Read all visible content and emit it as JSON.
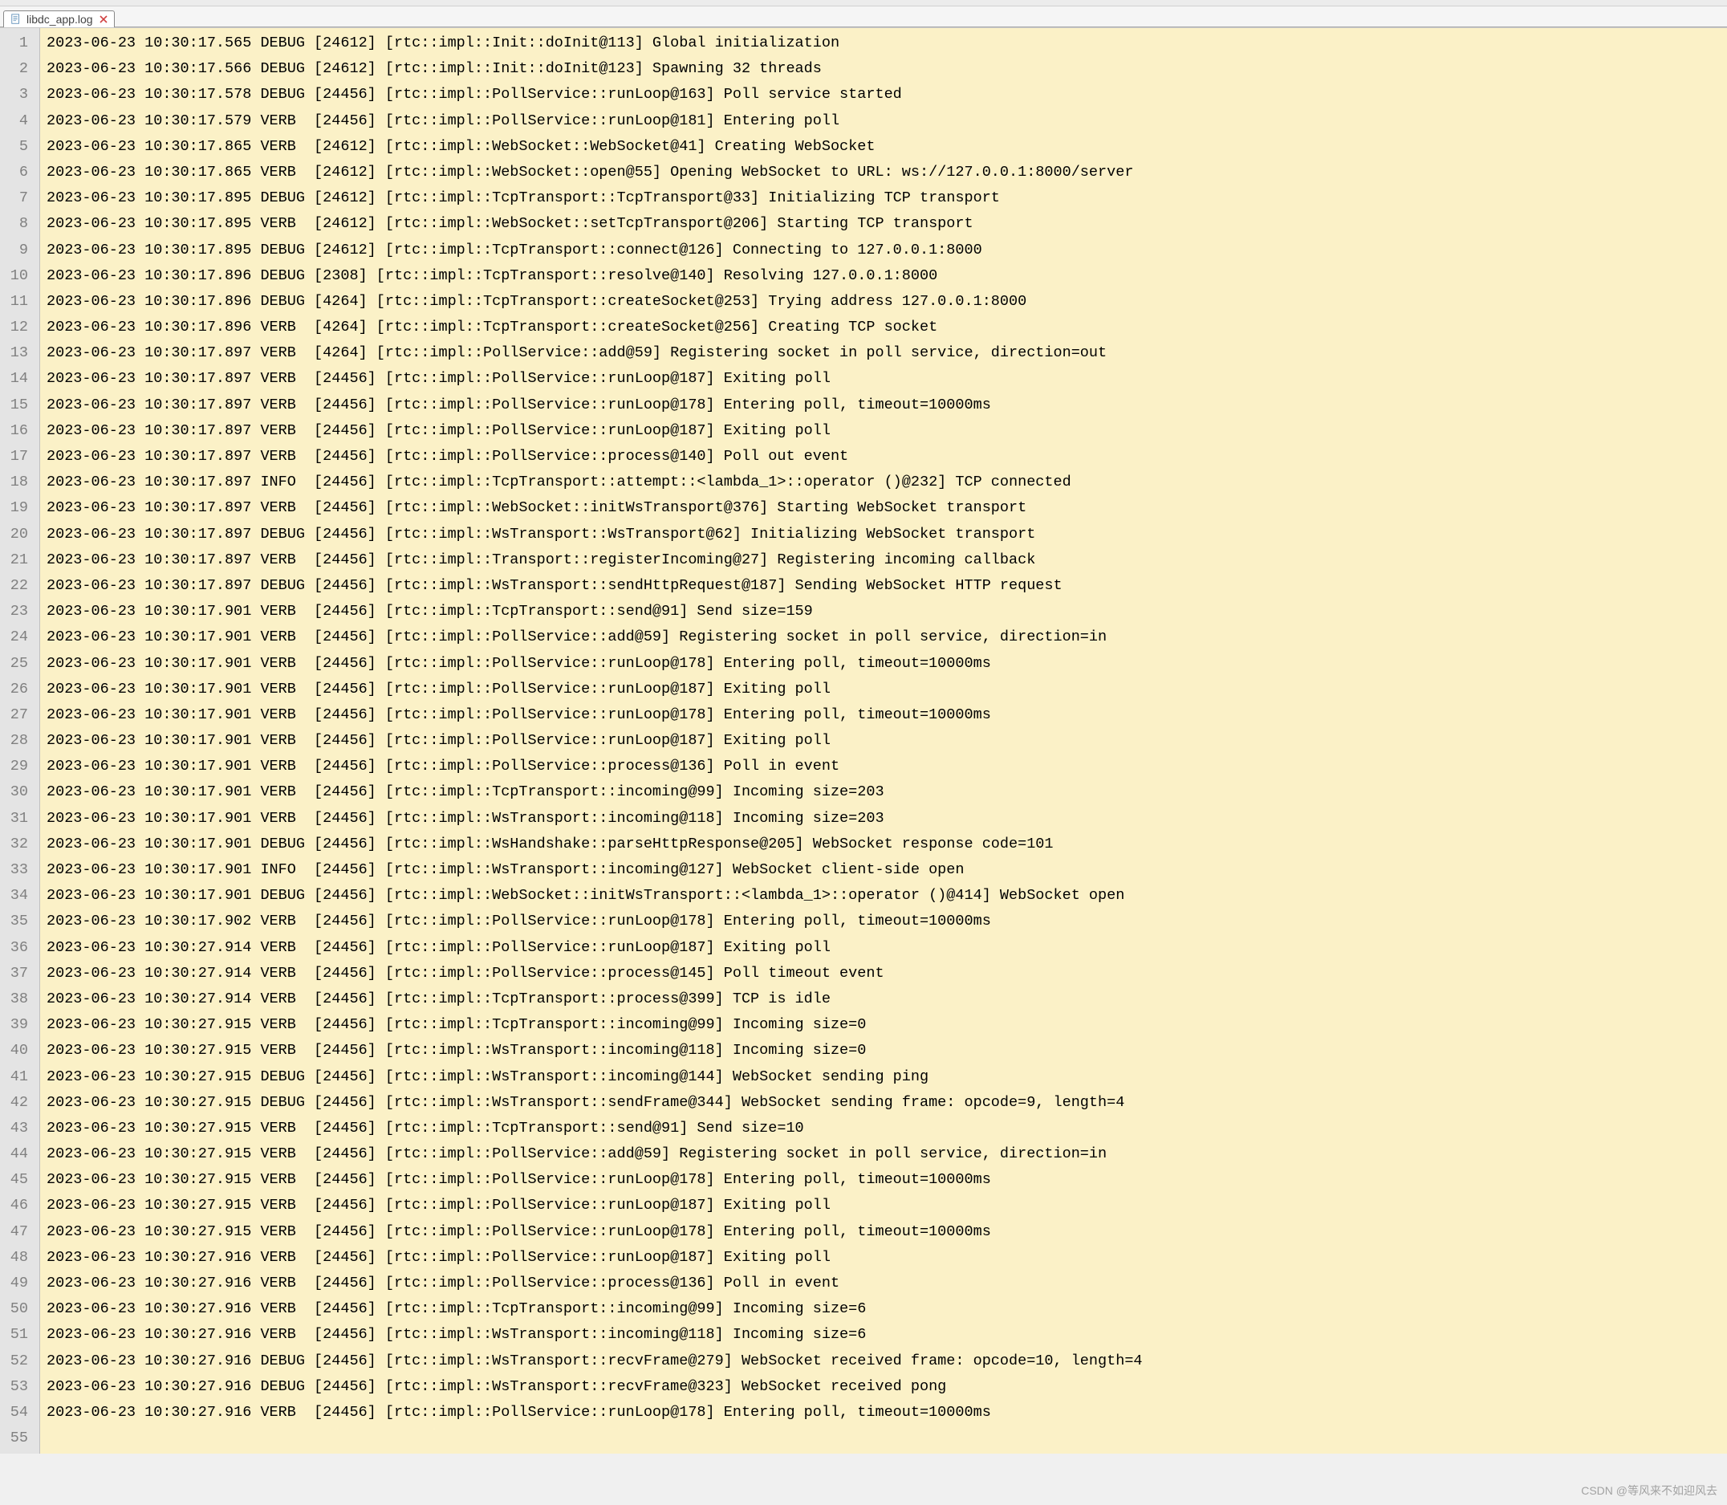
{
  "tab": {
    "filename": "libdc_app.log",
    "icon": "file-icon",
    "close": "close-icon"
  },
  "watermark": "CSDN @等风来不如迎风去",
  "log_lines": [
    "2023-06-23 10:30:17.565 DEBUG [24612] [rtc::impl::Init::doInit@113] Global initialization",
    "2023-06-23 10:30:17.566 DEBUG [24612] [rtc::impl::Init::doInit@123] Spawning 32 threads",
    "2023-06-23 10:30:17.578 DEBUG [24456] [rtc::impl::PollService::runLoop@163] Poll service started",
    "2023-06-23 10:30:17.579 VERB  [24456] [rtc::impl::PollService::runLoop@181] Entering poll",
    "2023-06-23 10:30:17.865 VERB  [24612] [rtc::impl::WebSocket::WebSocket@41] Creating WebSocket",
    "2023-06-23 10:30:17.865 VERB  [24612] [rtc::impl::WebSocket::open@55] Opening WebSocket to URL: ws://127.0.0.1:8000/server",
    "2023-06-23 10:30:17.895 DEBUG [24612] [rtc::impl::TcpTransport::TcpTransport@33] Initializing TCP transport",
    "2023-06-23 10:30:17.895 VERB  [24612] [rtc::impl::WebSocket::setTcpTransport@206] Starting TCP transport",
    "2023-06-23 10:30:17.895 DEBUG [24612] [rtc::impl::TcpTransport::connect@126] Connecting to 127.0.0.1:8000",
    "2023-06-23 10:30:17.896 DEBUG [2308] [rtc::impl::TcpTransport::resolve@140] Resolving 127.0.0.1:8000",
    "2023-06-23 10:30:17.896 DEBUG [4264] [rtc::impl::TcpTransport::createSocket@253] Trying address 127.0.0.1:8000",
    "2023-06-23 10:30:17.896 VERB  [4264] [rtc::impl::TcpTransport::createSocket@256] Creating TCP socket",
    "2023-06-23 10:30:17.897 VERB  [4264] [rtc::impl::PollService::add@59] Registering socket in poll service, direction=out",
    "2023-06-23 10:30:17.897 VERB  [24456] [rtc::impl::PollService::runLoop@187] Exiting poll",
    "2023-06-23 10:30:17.897 VERB  [24456] [rtc::impl::PollService::runLoop@178] Entering poll, timeout=10000ms",
    "2023-06-23 10:30:17.897 VERB  [24456] [rtc::impl::PollService::runLoop@187] Exiting poll",
    "2023-06-23 10:30:17.897 VERB  [24456] [rtc::impl::PollService::process@140] Poll out event",
    "2023-06-23 10:30:17.897 INFO  [24456] [rtc::impl::TcpTransport::attempt::<lambda_1>::operator ()@232] TCP connected",
    "2023-06-23 10:30:17.897 VERB  [24456] [rtc::impl::WebSocket::initWsTransport@376] Starting WebSocket transport",
    "2023-06-23 10:30:17.897 DEBUG [24456] [rtc::impl::WsTransport::WsTransport@62] Initializing WebSocket transport",
    "2023-06-23 10:30:17.897 VERB  [24456] [rtc::impl::Transport::registerIncoming@27] Registering incoming callback",
    "2023-06-23 10:30:17.897 DEBUG [24456] [rtc::impl::WsTransport::sendHttpRequest@187] Sending WebSocket HTTP request",
    "2023-06-23 10:30:17.901 VERB  [24456] [rtc::impl::TcpTransport::send@91] Send size=159",
    "2023-06-23 10:30:17.901 VERB  [24456] [rtc::impl::PollService::add@59] Registering socket in poll service, direction=in",
    "2023-06-23 10:30:17.901 VERB  [24456] [rtc::impl::PollService::runLoop@178] Entering poll, timeout=10000ms",
    "2023-06-23 10:30:17.901 VERB  [24456] [rtc::impl::PollService::runLoop@187] Exiting poll",
    "2023-06-23 10:30:17.901 VERB  [24456] [rtc::impl::PollService::runLoop@178] Entering poll, timeout=10000ms",
    "2023-06-23 10:30:17.901 VERB  [24456] [rtc::impl::PollService::runLoop@187] Exiting poll",
    "2023-06-23 10:30:17.901 VERB  [24456] [rtc::impl::PollService::process@136] Poll in event",
    "2023-06-23 10:30:17.901 VERB  [24456] [rtc::impl::TcpTransport::incoming@99] Incoming size=203",
    "2023-06-23 10:30:17.901 VERB  [24456] [rtc::impl::WsTransport::incoming@118] Incoming size=203",
    "2023-06-23 10:30:17.901 DEBUG [24456] [rtc::impl::WsHandshake::parseHttpResponse@205] WebSocket response code=101",
    "2023-06-23 10:30:17.901 INFO  [24456] [rtc::impl::WsTransport::incoming@127] WebSocket client-side open",
    "2023-06-23 10:30:17.901 DEBUG [24456] [rtc::impl::WebSocket::initWsTransport::<lambda_1>::operator ()@414] WebSocket open",
    "2023-06-23 10:30:17.902 VERB  [24456] [rtc::impl::PollService::runLoop@178] Entering poll, timeout=10000ms",
    "2023-06-23 10:30:27.914 VERB  [24456] [rtc::impl::PollService::runLoop@187] Exiting poll",
    "2023-06-23 10:30:27.914 VERB  [24456] [rtc::impl::PollService::process@145] Poll timeout event",
    "2023-06-23 10:30:27.914 VERB  [24456] [rtc::impl::TcpTransport::process@399] TCP is idle",
    "2023-06-23 10:30:27.915 VERB  [24456] [rtc::impl::TcpTransport::incoming@99] Incoming size=0",
    "2023-06-23 10:30:27.915 VERB  [24456] [rtc::impl::WsTransport::incoming@118] Incoming size=0",
    "2023-06-23 10:30:27.915 DEBUG [24456] [rtc::impl::WsTransport::incoming@144] WebSocket sending ping",
    "2023-06-23 10:30:27.915 DEBUG [24456] [rtc::impl::WsTransport::sendFrame@344] WebSocket sending frame: opcode=9, length=4",
    "2023-06-23 10:30:27.915 VERB  [24456] [rtc::impl::TcpTransport::send@91] Send size=10",
    "2023-06-23 10:30:27.915 VERB  [24456] [rtc::impl::PollService::add@59] Registering socket in poll service, direction=in",
    "2023-06-23 10:30:27.915 VERB  [24456] [rtc::impl::PollService::runLoop@178] Entering poll, timeout=10000ms",
    "2023-06-23 10:30:27.915 VERB  [24456] [rtc::impl::PollService::runLoop@187] Exiting poll",
    "2023-06-23 10:30:27.915 VERB  [24456] [rtc::impl::PollService::runLoop@178] Entering poll, timeout=10000ms",
    "2023-06-23 10:30:27.916 VERB  [24456] [rtc::impl::PollService::runLoop@187] Exiting poll",
    "2023-06-23 10:30:27.916 VERB  [24456] [rtc::impl::PollService::process@136] Poll in event",
    "2023-06-23 10:30:27.916 VERB  [24456] [rtc::impl::TcpTransport::incoming@99] Incoming size=6",
    "2023-06-23 10:30:27.916 VERB  [24456] [rtc::impl::WsTransport::incoming@118] Incoming size=6",
    "2023-06-23 10:30:27.916 DEBUG [24456] [rtc::impl::WsTransport::recvFrame@279] WebSocket received frame: opcode=10, length=4",
    "2023-06-23 10:30:27.916 DEBUG [24456] [rtc::impl::WsTransport::recvFrame@323] WebSocket received pong",
    "2023-06-23 10:30:27.916 VERB  [24456] [rtc::impl::PollService::runLoop@178] Entering poll, timeout=10000ms",
    ""
  ]
}
